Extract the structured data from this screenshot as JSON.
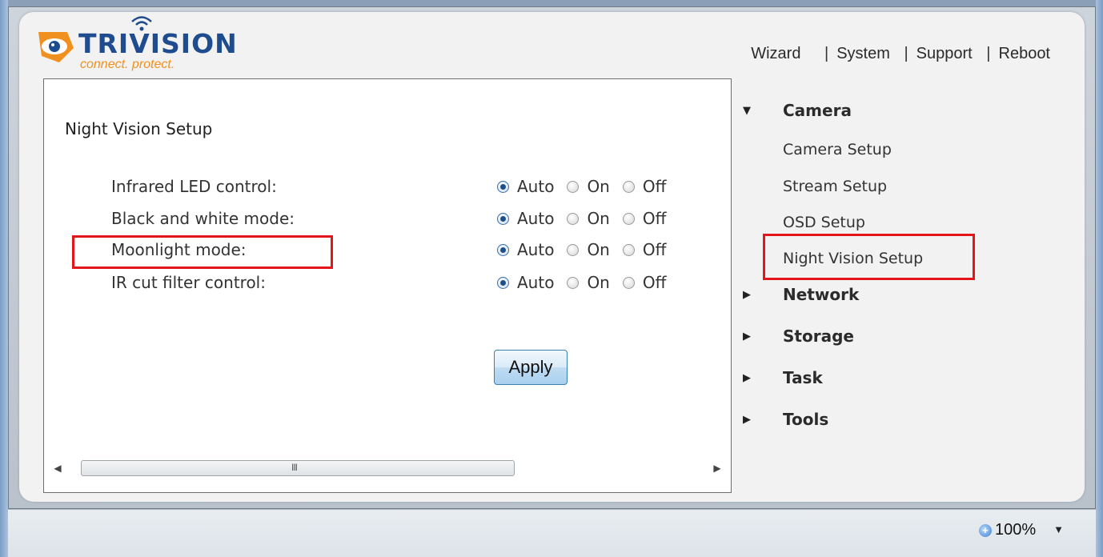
{
  "logo": {
    "brand": "TRIVISION",
    "tagline": "connect. protect."
  },
  "topnav": {
    "items": [
      "Wizard",
      "System",
      "Support",
      "Reboot"
    ],
    "separator": "|"
  },
  "panel": {
    "title": "Night Vision Setup",
    "rows": [
      {
        "label": "Infrared LED control:",
        "selected": "Auto"
      },
      {
        "label": "Black and white mode:",
        "selected": "Auto"
      },
      {
        "label": "Moonlight mode:",
        "selected": "Auto"
      },
      {
        "label": "IR cut filter control:",
        "selected": "Auto"
      }
    ],
    "options": [
      "Auto",
      "On",
      "Off"
    ],
    "apply_label": "Apply",
    "scroll_grip": "III"
  },
  "sidebar": {
    "sections": [
      {
        "label": "Camera",
        "expanded": true,
        "items": [
          "Camera Setup",
          "Stream Setup",
          "OSD Setup",
          "Night Vision Setup"
        ]
      },
      {
        "label": "Network",
        "expanded": false
      },
      {
        "label": "Storage",
        "expanded": false
      },
      {
        "label": "Task",
        "expanded": false
      },
      {
        "label": "Tools",
        "expanded": false
      }
    ]
  },
  "statusbar": {
    "zoom": "100%"
  },
  "colors": {
    "brand_blue": "#1f4c8f",
    "brand_orange": "#f0901e",
    "highlight_red": "#e4151b"
  }
}
